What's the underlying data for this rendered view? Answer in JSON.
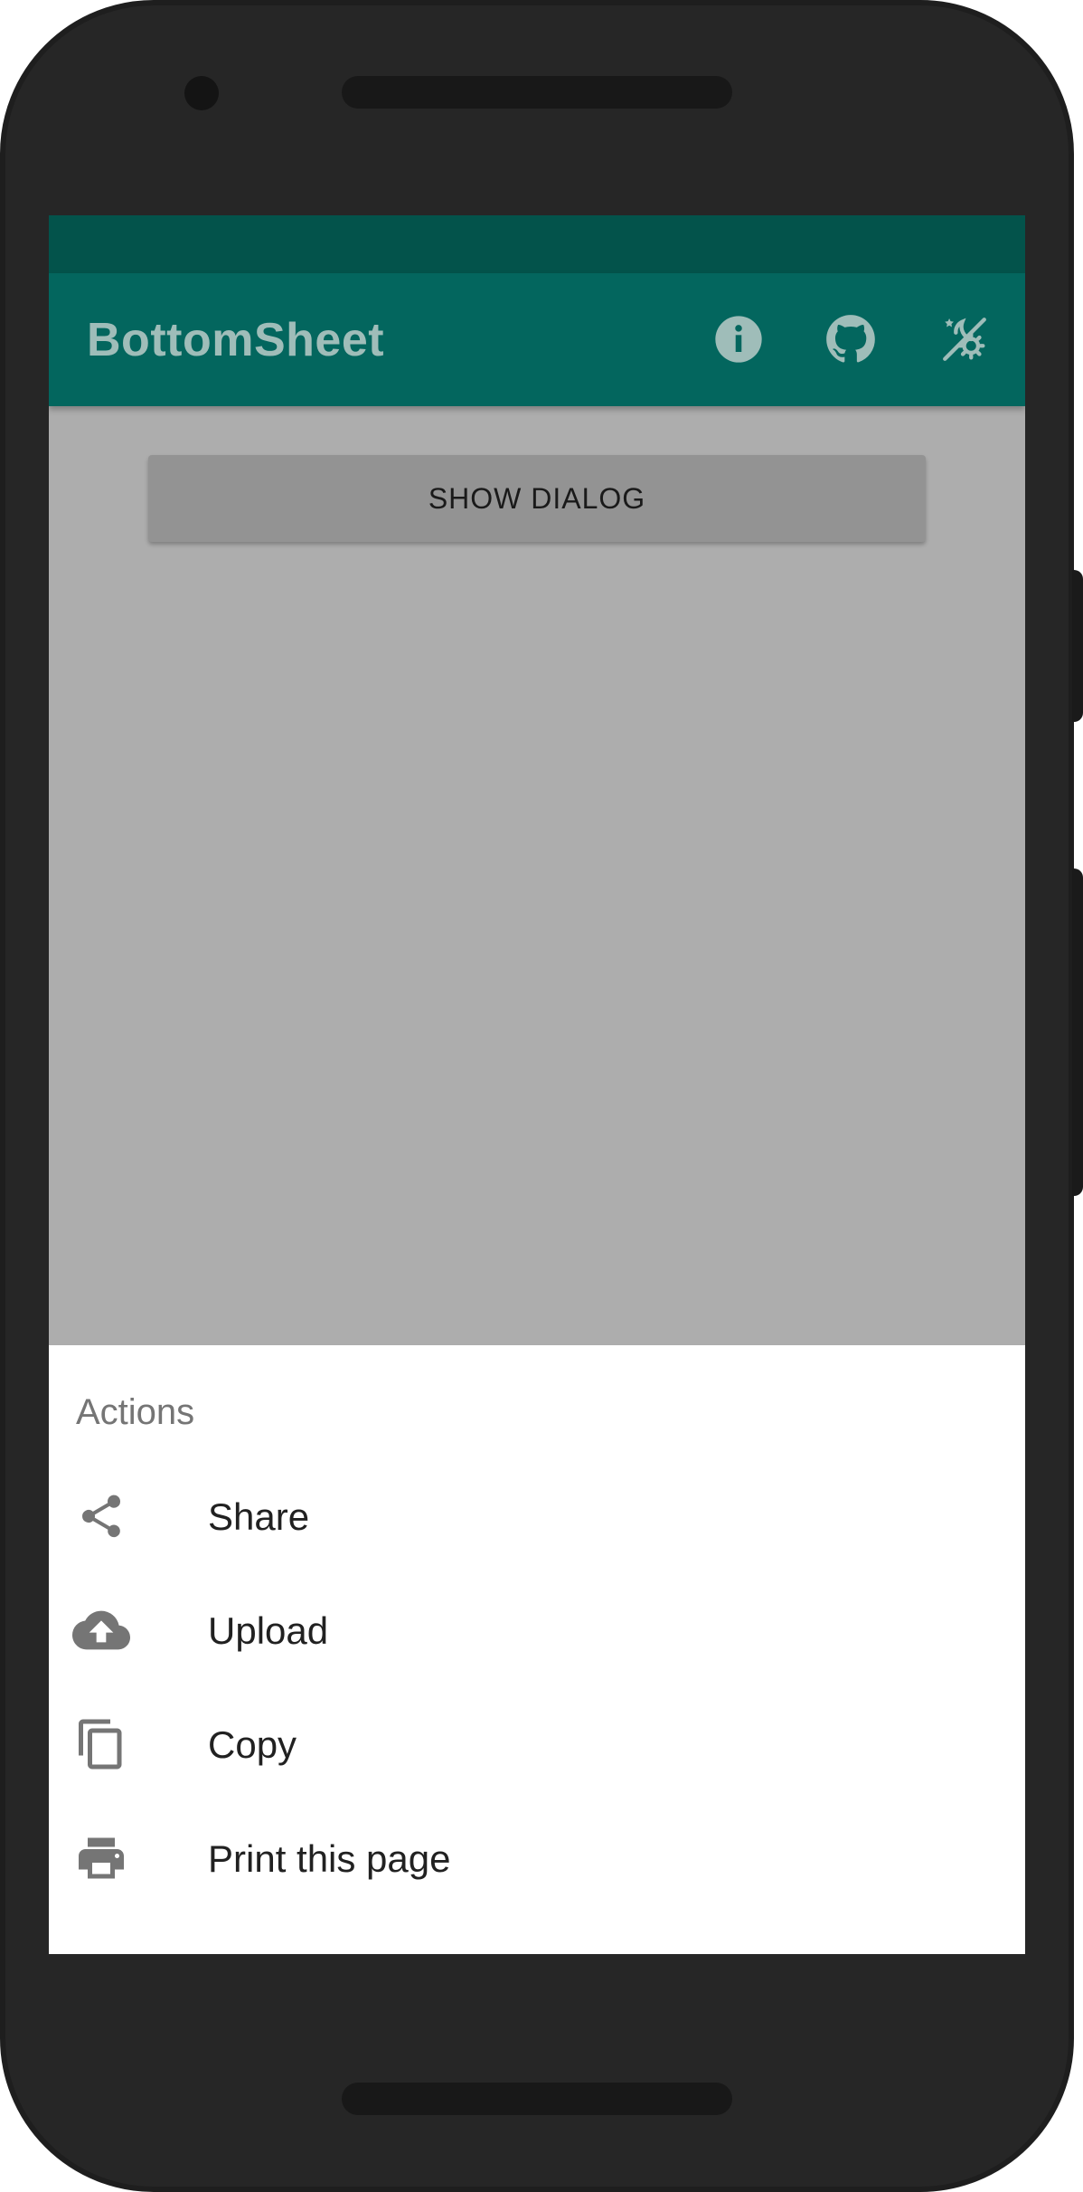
{
  "app_bar": {
    "title": "BottomSheet",
    "actions": [
      {
        "icon": "info-icon"
      },
      {
        "icon": "github-icon"
      },
      {
        "icon": "theme-toggle-icon"
      }
    ]
  },
  "main": {
    "show_dialog_label": "SHOW DIALOG"
  },
  "bottom_sheet": {
    "title": "Actions",
    "items": [
      {
        "label": "Share",
        "icon": "share-icon"
      },
      {
        "label": "Upload",
        "icon": "cloud-upload-icon"
      },
      {
        "label": "Copy",
        "icon": "copy-icon"
      },
      {
        "label": "Print this page",
        "icon": "print-icon"
      }
    ]
  },
  "colors": {
    "status_bar": "#03534b",
    "app_bar": "#03665e",
    "scrim_background": "#adadad",
    "sheet_icon": "#757575"
  }
}
